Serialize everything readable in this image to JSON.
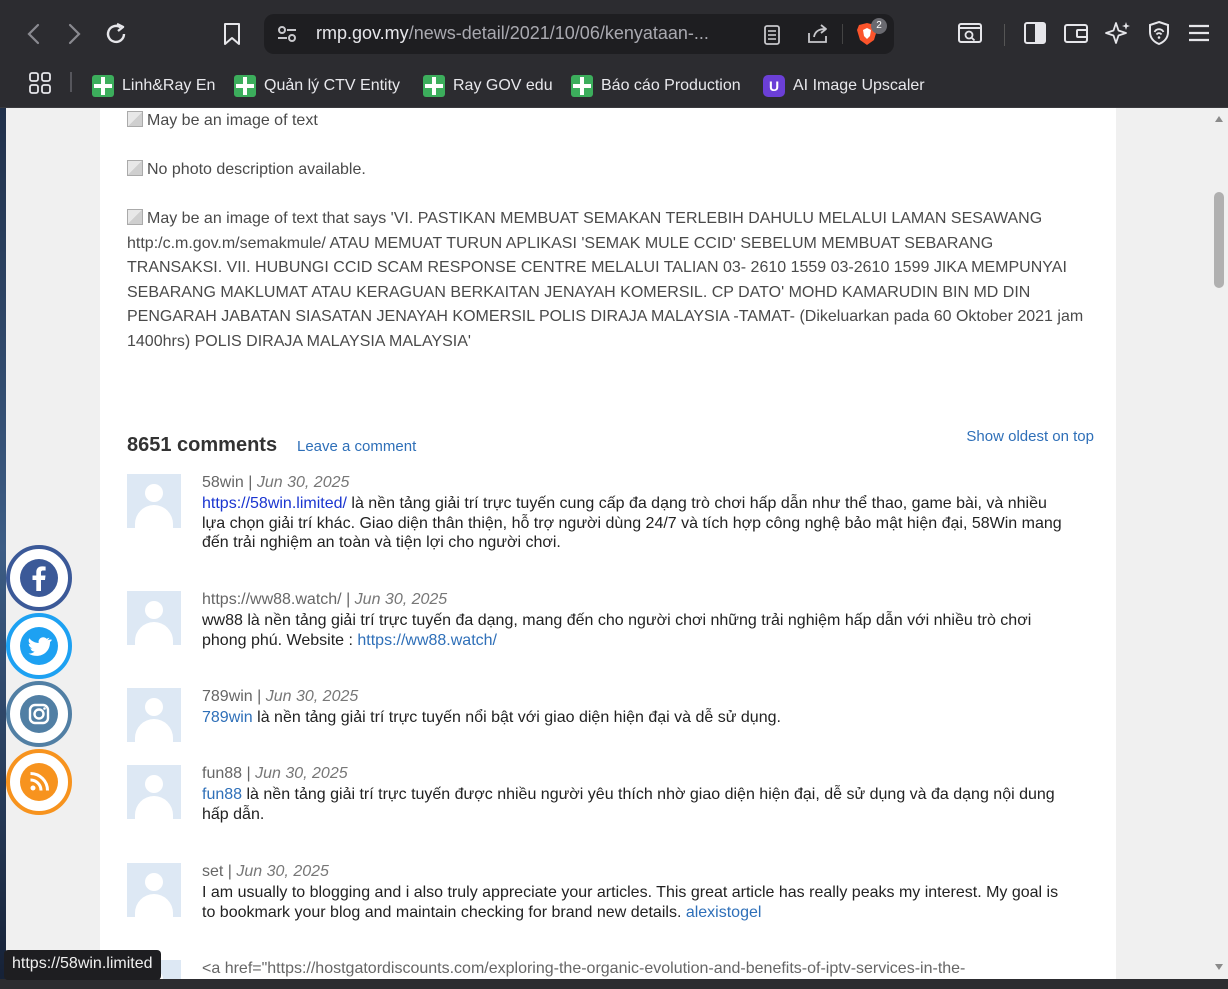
{
  "browser": {
    "url_main": "rmp.gov.my",
    "url_path": "/news-detail/2021/10/06/kenyataan-...",
    "brave_badge_count": "2",
    "status_url": "https://58win.limited",
    "bookmarks": [
      {
        "label": "Linh&Ray En",
        "icon": "green-plus"
      },
      {
        "label": "Quản lý CTV Entity",
        "icon": "green-plus"
      },
      {
        "label": "Ray GOV edu",
        "icon": "green-plus"
      },
      {
        "label": "Báo cáo Production",
        "icon": "green-plus"
      },
      {
        "label": "AI Image Upscaler",
        "icon": "ai-upscaler"
      }
    ]
  },
  "article": {
    "img1_alt": "May be an image of text",
    "img2_alt": "No photo description available.",
    "img3_alt": "May be an image of text that says 'VI. PASTIKAN MEMBUAT SEMAKAN TERLEBIH DAHULU MELALUI LAMAN SESAWANG http:/c.m.gov.m/semakmule/ ATAU MEMUAT TURUN APLIKASI 'SEMAK MULE CCID' SEBELUM MEMBUAT SEBARANG TRANSAKSI. VII. HUBUNGI CCID SCAM RESPONSE CENTRE MELALUI TALIAN 03- 2610 1559 03-2610 1599 JIKA MEMPUNYAI SEBARANG MAKLUMAT ATAU KERAGUAN BERKAITAN JENAYAH KOMERSIL. CP DATO' MOHD KAMARUDIN BIN MD DIN PENGARAH JABATAN SIASATAN JENAYAH KOMERSIL POLIS DIRAJA MALAYSIA -TAMAT- (Dikeluarkan pada 60 Oktober 2021 jam 1400hrs) POLIS DIRAJA MALAYSIA MALAYSIA'"
  },
  "comments": {
    "count_label": "8651 comments",
    "leave_label": "Leave a comment",
    "sort_label": "Show oldest on top",
    "items": [
      {
        "author": "58win",
        "sep": " | ",
        "date": "Jun 30, 2025",
        "link_text": "https://58win.limited/",
        "text": " là nền tảng giải trí trực tuyến cung cấp đa dạng trò chơi hấp dẫn như thể thao, game bài, và nhiều lựa chọn giải trí khác. Giao diện thân thiện, hỗ trợ người dùng 24/7 và tích hợp công nghệ bảo mật hiện đại, 58Win mang đến trải nghiệm an toàn và tiện lợi cho người chơi."
      },
      {
        "author": "https://ww88.watch/",
        "sep": " | ",
        "date": "Jun 30, 2025",
        "text": "ww88 là nền tảng giải trí trực tuyến đa dạng, mang đến cho người chơi những trải nghiệm hấp dẫn với nhiều trò chơi phong phú. Website : ",
        "link_text": "https://ww88.watch/"
      },
      {
        "author": "789win",
        "sep": " | ",
        "date": "Jun 30, 2025",
        "link_text": "789win",
        "text": " là nền tảng giải trí trực tuyến nổi bật với giao diện hiện đại và dễ sử dụng."
      },
      {
        "author": "fun88",
        "sep": " | ",
        "date": "Jun 30, 2025",
        "link_text": "fun88",
        "text": " là nền tảng giải trí trực tuyến được nhiều người yêu thích nhờ giao diện hiện đại, dễ sử dụng và đa dạng nội dung hấp dẫn."
      },
      {
        "author": "set",
        "sep": " | ",
        "date": "Jun 30, 2025",
        "text": "I am usually to blogging and i also truly appreciate your articles. This great article has really peaks my interest. My goal is to bookmark your blog and maintain checking for brand new details. ",
        "link_text": "alexistogel"
      },
      {
        "partial_text": "<a href=\"https://hostgatordiscounts.com/exploring-the-organic-evolution-and-benefits-of-iptv-services-in-the-"
      }
    ]
  },
  "social": [
    {
      "name": "facebook",
      "color": "#3b5998"
    },
    {
      "name": "twitter",
      "color": "#1da1f2"
    },
    {
      "name": "instagram",
      "color": "#517fa4"
    },
    {
      "name": "rss",
      "color": "#f7931e"
    }
  ]
}
